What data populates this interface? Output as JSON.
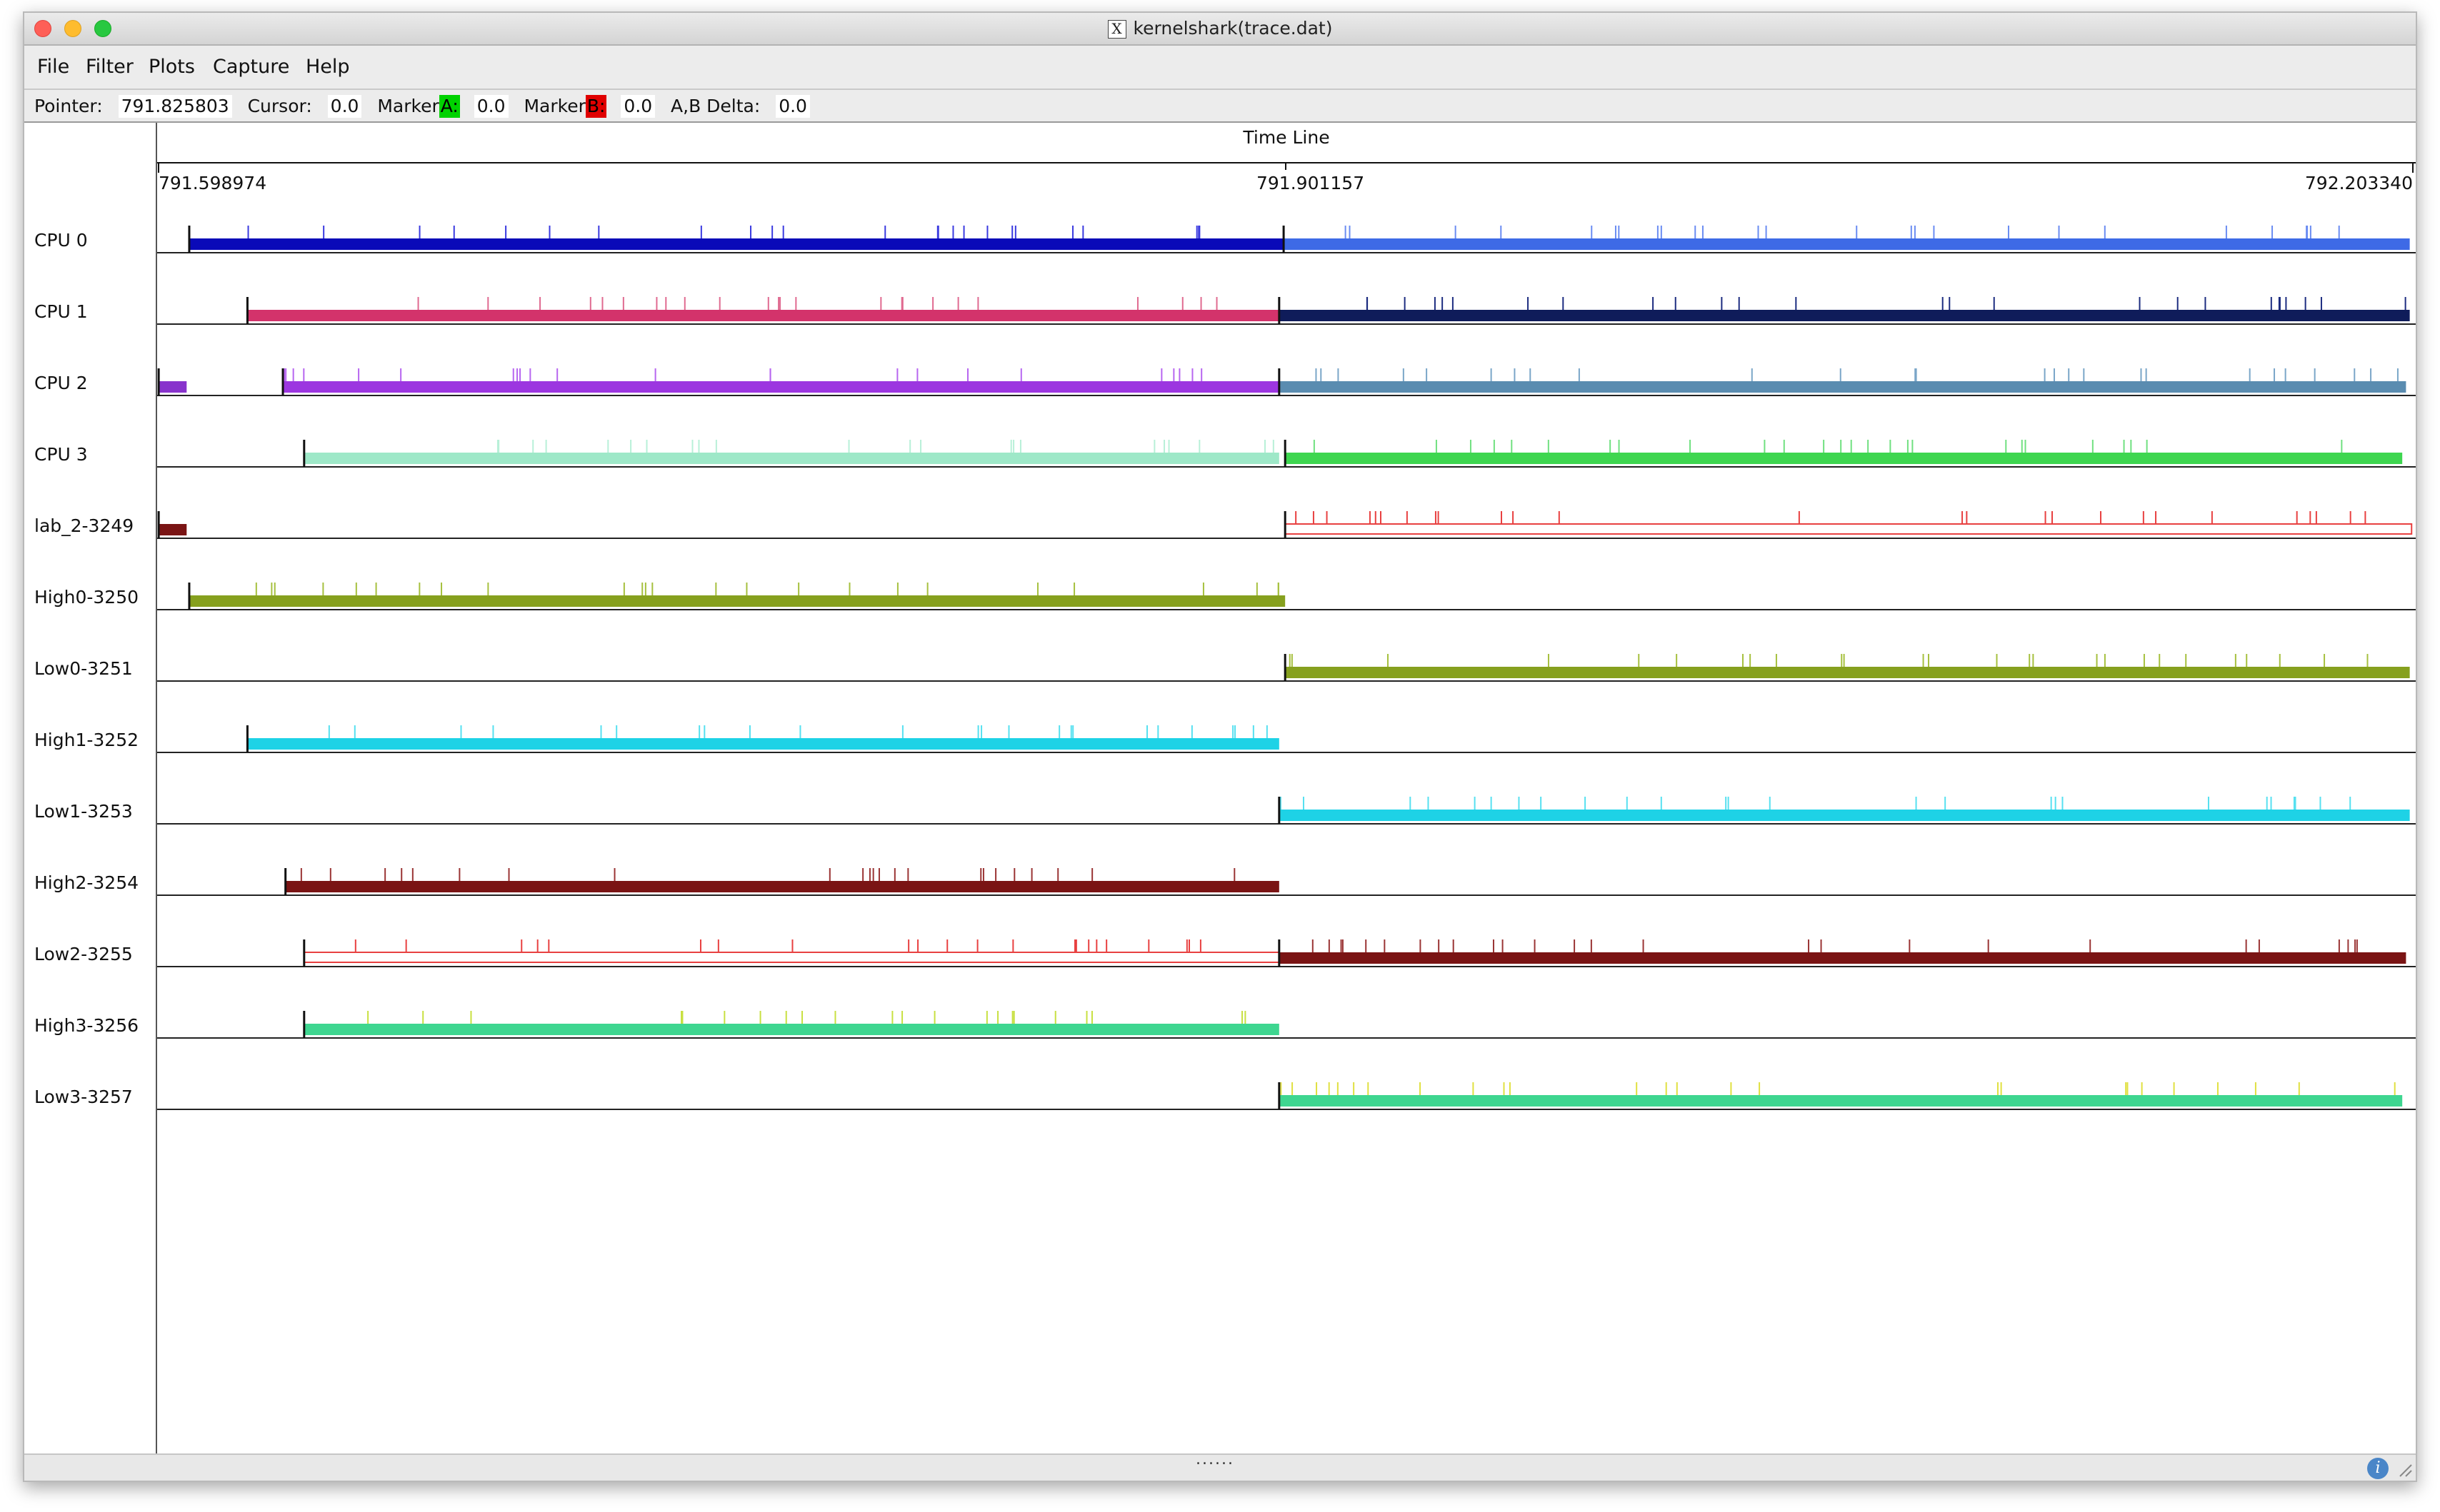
{
  "window": {
    "title": "kernelshark(trace.dat)",
    "x_glyph": "X"
  },
  "menu": [
    {
      "label": "File"
    },
    {
      "label": "Filter"
    },
    {
      "label": "Plots"
    },
    {
      "label": "Capture"
    },
    {
      "label": "Help"
    }
  ],
  "info": {
    "pointer_label": "Pointer:",
    "pointer_value": "791.825803",
    "cursor_label": "Cursor:",
    "cursor_value": "0.0",
    "marker_a_label": "Marker",
    "marker_a_letter": "A:",
    "marker_a_value": "0.0",
    "marker_b_label": "Marker",
    "marker_b_letter": "B:",
    "marker_b_value": "0.0",
    "delta_label": "A,B Delta:",
    "delta_value": "0.0",
    "marker_a_color": "#00d200",
    "marker_b_color": "#e00000"
  },
  "timeline": {
    "title": "Time Line",
    "start": "791.598974",
    "mid": "791.901157",
    "end": "792.203340",
    "t_start": 791.598974,
    "t_end": 792.20334
  },
  "rows": [
    {
      "label": "CPU 0",
      "segments": [
        {
          "t0": 791.6072,
          "t1": 791.9006,
          "color": "#0a0ab8",
          "ticks": "#3a3ae0"
        },
        {
          "t0": 791.9006,
          "t1": 792.2025,
          "color": "#3e6ae6",
          "ticks": "#6a8cf2"
        }
      ]
    },
    {
      "label": "CPU 1",
      "segments": [
        {
          "t0": 791.6228,
          "t1": 791.8994,
          "color": "#d3336b",
          "ticks": "#e06a90"
        },
        {
          "t0": 791.8994,
          "t1": 792.2025,
          "color": "#0f1c5a",
          "ticks": "#1c2c80"
        }
      ]
    },
    {
      "label": "CPU 2",
      "segments": [
        {
          "t0": 791.599,
          "t1": 791.6065,
          "color": "#8833cc",
          "ticks": "#8833cc"
        },
        {
          "t0": 791.6323,
          "t1": 791.8994,
          "color": "#9c36e0",
          "ticks": "#b766f0"
        },
        {
          "t0": 791.8994,
          "t1": 792.2015,
          "color": "#5a8cb0",
          "ticks": "#7aa6c8"
        }
      ]
    },
    {
      "label": "CPU 3",
      "segments": [
        {
          "t0": 791.638,
          "t1": 791.8994,
          "color": "#9ee8c8",
          "ticks": "#b8f0d8"
        },
        {
          "t0": 791.901,
          "t1": 792.2005,
          "color": "#3ed650",
          "ticks": "#70e080"
        }
      ]
    },
    {
      "label": "lab_2-3249",
      "segments": [
        {
          "t0": 791.599,
          "t1": 791.6065,
          "color": "#7a1414",
          "ticks": "#7a1414"
        },
        {
          "t0": 791.901,
          "t1": 792.203,
          "color": "#e84040",
          "ticks": "#e84040",
          "outline": true
        }
      ]
    },
    {
      "label": "High0-3250",
      "segments": [
        {
          "t0": 791.6072,
          "t1": 791.901,
          "color": "#86a01e",
          "ticks": "#a6c03e"
        }
      ]
    },
    {
      "label": "Low0-3251",
      "segments": [
        {
          "t0": 791.901,
          "t1": 792.2025,
          "color": "#86a01e",
          "ticks": "#a6c03e"
        }
      ]
    },
    {
      "label": "High1-3252",
      "segments": [
        {
          "t0": 791.6228,
          "t1": 791.8994,
          "color": "#1ed2e6",
          "ticks": "#56e0f0"
        }
      ]
    },
    {
      "label": "Low1-3253",
      "segments": [
        {
          "t0": 791.8994,
          "t1": 792.2025,
          "color": "#1ed2e6",
          "ticks": "#56e0f0"
        }
      ]
    },
    {
      "label": "High2-3254",
      "segments": [
        {
          "t0": 791.633,
          "t1": 791.8994,
          "color": "#7a1414",
          "ticks": "#9a3434"
        }
      ]
    },
    {
      "label": "Low2-3255",
      "segments": [
        {
          "t0": 791.638,
          "t1": 791.8994,
          "color": "#e84040",
          "ticks": "#e84040",
          "outline": true
        },
        {
          "t0": 791.8994,
          "t1": 792.2015,
          "color": "#7a1414",
          "ticks": "#9a3434"
        }
      ]
    },
    {
      "label": "High3-3256",
      "segments": [
        {
          "t0": 791.638,
          "t1": 791.8994,
          "color": "#3ed690",
          "ticks": "#c8e040"
        }
      ]
    },
    {
      "label": "Low3-3257",
      "segments": [
        {
          "t0": 791.8994,
          "t1": 792.2005,
          "color": "#3ed690",
          "ticks": "#e0e040"
        }
      ]
    }
  ],
  "statusbar": {
    "grip": "......",
    "info_glyph": "i"
  }
}
